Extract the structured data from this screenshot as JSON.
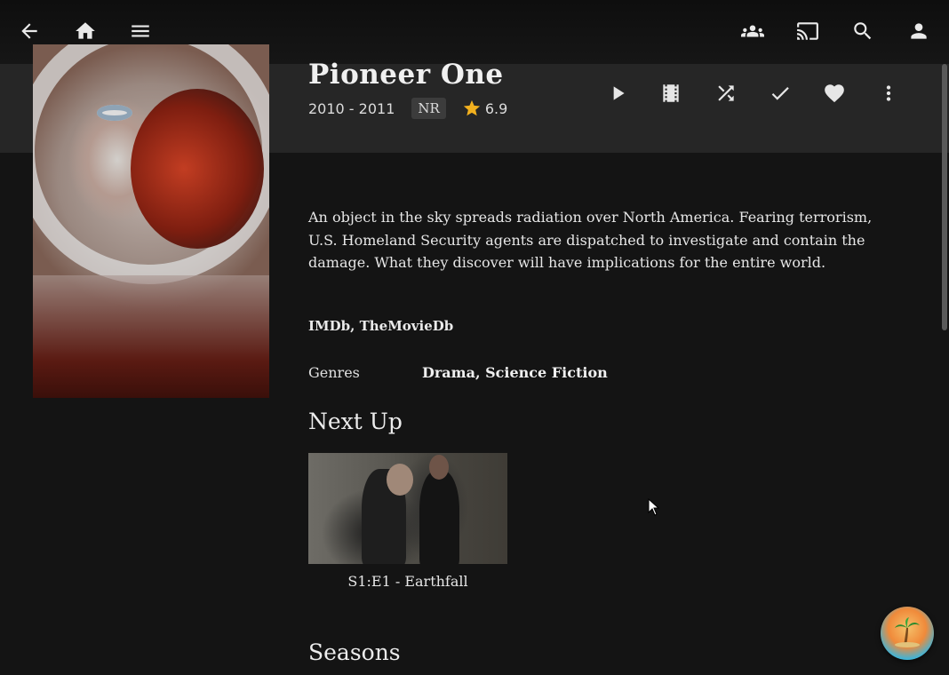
{
  "header": {
    "icons": {
      "back": "arrow-left-icon",
      "home": "home-icon",
      "menu": "menu-icon",
      "users": "users-icon",
      "cast": "cast-icon",
      "search": "search-icon",
      "profile": "user-icon"
    }
  },
  "item": {
    "title": "Pioneer One",
    "years": "2010 - 2011",
    "rating_badge": "NR",
    "community_rating": "6.9",
    "star_color": "#f2b01e",
    "overview": "An object in the sky spreads radiation over North America. Fearing terrorism, U.S. Homeland Security agents are dispatched to investigate and contain the damage. What they discover will have implications for the entire world.",
    "links": [
      "IMDb",
      "TheMovieDb"
    ],
    "links_separator": ", ",
    "genres_label": "Genres",
    "genres": "Drama, Science Fiction"
  },
  "actions": [
    "play-icon",
    "trailer-icon",
    "shuffle-icon",
    "played-check-icon",
    "favorite-heart-icon",
    "more-icon"
  ],
  "next_up": {
    "heading": "Next Up",
    "episode_label": "S1:E1 - Earthfall"
  },
  "seasons": {
    "heading": "Seasons"
  },
  "colors": {
    "background": "#141414",
    "band": "#262626",
    "text": "#e6e6e6"
  }
}
